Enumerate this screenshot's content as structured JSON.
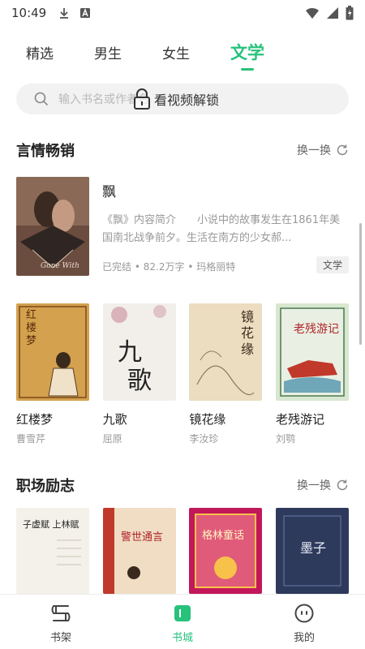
{
  "status_bar": {
    "time": "10:49"
  },
  "tabs": [
    {
      "label": "精选",
      "active": false
    },
    {
      "label": "男生",
      "active": false
    },
    {
      "label": "女生",
      "active": false
    },
    {
      "label": "文学",
      "active": true
    }
  ],
  "search": {
    "placeholder": "输入书名或作者名",
    "overlay_text": "看视频解锁"
  },
  "sections": [
    {
      "title": "言情畅销",
      "refresh_label": "换一换",
      "featured": {
        "title": "飘",
        "description": "《飘》内容简介　　小说中的故事发生在1861年美国南北战争前夕。生活在南方的少女郝...",
        "status": "已完结",
        "word_count": "82.2万字",
        "author": "玛格丽特",
        "genre": "文学"
      },
      "books": [
        {
          "title": "红楼梦",
          "author": "曹雪芹"
        },
        {
          "title": "九歌",
          "author": "屈原"
        },
        {
          "title": "镜花缘",
          "author": "李汝珍"
        },
        {
          "title": "老残游记",
          "author": "刘鹗"
        }
      ]
    },
    {
      "title": "职场励志",
      "refresh_label": "换一换",
      "books": [
        {
          "cover_text": "子虚赋 上林赋"
        },
        {
          "cover_text": "警世通言"
        },
        {
          "cover_text": "格林童话"
        },
        {
          "cover_text": "墨子"
        }
      ]
    }
  ],
  "bottom_nav": [
    {
      "label": "书架",
      "icon": "bookshelf-icon",
      "active": false
    },
    {
      "label": "书城",
      "icon": "bookstore-icon",
      "active": true
    },
    {
      "label": "我的",
      "icon": "profile-icon",
      "active": false
    }
  ],
  "colors": {
    "accent": "#27c27b"
  }
}
